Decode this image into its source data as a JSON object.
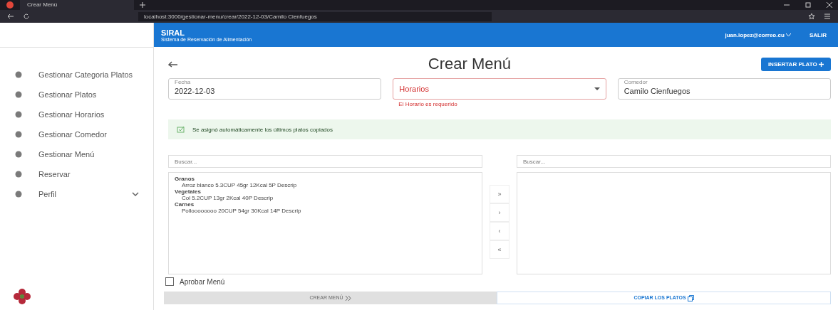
{
  "browser": {
    "tab_title": "Crear Menú",
    "url": "localhost:3000/gestionar-menu/crear/2022-12-03/Camilo Cienfuegos"
  },
  "header": {
    "app_name": "SIRAL",
    "subtitle": "Sistema de Reservación de Alimentación",
    "user": "juan.lopez@correo.cu",
    "logout": "SALIR"
  },
  "sidebar": {
    "items": [
      {
        "label": "Gestionar Categoria Platos",
        "expandable": false
      },
      {
        "label": "Gestionar Platos",
        "expandable": false
      },
      {
        "label": "Gestionar Horarios",
        "expandable": false
      },
      {
        "label": "Gestionar Comedor",
        "expandable": false
      },
      {
        "label": "Gestionar Menú",
        "expandable": false
      },
      {
        "label": "Reservar",
        "expandable": false
      },
      {
        "label": "Perfil",
        "expandable": true
      }
    ]
  },
  "page": {
    "title": "Crear Menú",
    "insert_button": "INSERTAR PLATO",
    "fields": [
      {
        "label": "Fecha",
        "value": "2022-12-03",
        "kind": "text",
        "error": false
      },
      {
        "placeholder": "Horarios",
        "kind": "select",
        "error": true,
        "helper": "El Horario es requerido"
      },
      {
        "label": "Comedor",
        "value": "Camilo Cienfuegos",
        "kind": "text",
        "error": false
      }
    ],
    "alert": "Se asignó automáticamente los últimos platos copiados",
    "source": {
      "search_placeholder": "Buscar...",
      "groups": [
        {
          "name": "Granos",
          "items": [
            "Arroz blanco 5.3CUP 45gr 12Kcal 5P Descrip"
          ]
        },
        {
          "name": "Vegetales",
          "items": [
            "Col 5.2CUP 13gr 2Kcal 40P Descrip"
          ]
        },
        {
          "name": "Carnes",
          "items": [
            "Polloooooooo 20CUP 54gr 30Kcal 14P Descrip"
          ]
        }
      ]
    },
    "transfer_buttons": [
      "»",
      "›",
      "‹",
      "«"
    ],
    "target": {
      "search_placeholder": "Buscar..."
    },
    "approve": {
      "label": "Aprobar Menú",
      "checked": false
    },
    "create_button": {
      "label": "CREAR MENÚ",
      "disabled": true
    },
    "copy_button": {
      "label": "COPIAR LOS PLATOS"
    }
  }
}
